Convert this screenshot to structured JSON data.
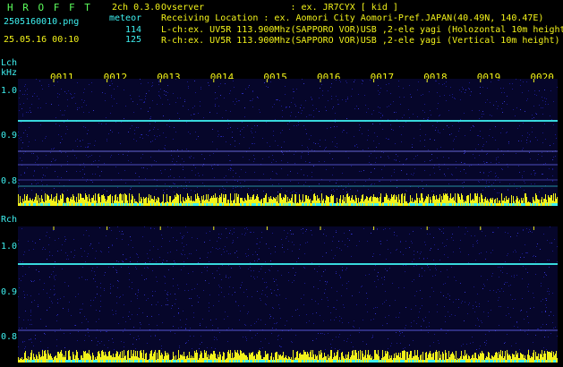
{
  "brand": "H R O F F T",
  "version": "2ch 0.3.0",
  "file": "2505160010.png",
  "datetime": "25.05.16 00:10",
  "meteor_label": "meteor",
  "lch_count": "114",
  "rch_count": "125",
  "info": {
    "observer": "Ovserver                : ex. JR7CYX [ kid ]",
    "location": "Receiving Location : ex. Aomori City Aomori-Pref.JAPAN(40.49N, 140.47E)",
    "lch": "L-ch:ex. UV5R 113.900Mhz(SAPPORO VOR)USB ,2-ele yagi (Holozontal 10m height",
    "rch": "R-ch:ex. UV5R 113.900Mhz(SAPPORO VOR)USB ,2-ele yagi (Vertical 10m height)"
  },
  "lch_label": "Lch",
  "khz_label": "kHz",
  "rch_label": "Rch",
  "time_ticks": [
    "0011",
    "0012",
    "0013",
    "0014",
    "0015",
    "0016",
    "0017",
    "0018",
    "0019",
    "0020"
  ],
  "freq_ticks": [
    "1.0",
    "0.9",
    "0.8"
  ],
  "colors": {
    "text_cyan": "#3ef0f0",
    "text_yellow": "#f2f21a",
    "brand_green": "#5cff5c",
    "background": "#000000",
    "noise_blue": "#101070"
  }
}
